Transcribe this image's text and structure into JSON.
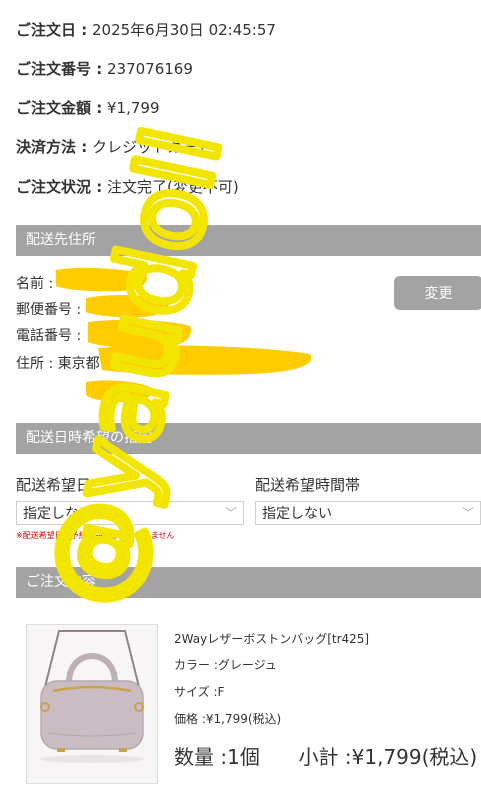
{
  "order": {
    "date": {
      "label": "ご注文日 :",
      "value": " 2025年6月30日 02:45:57"
    },
    "number": {
      "label": "ご注文番号 :",
      "value": " 237076169"
    },
    "amount": {
      "label": "ご注文金額 :",
      "value": " ¥1,799"
    },
    "payment": {
      "label": "決済方法 :",
      "value": " クレジットカード"
    },
    "status": {
      "label": "ご注文状況 :",
      "value": " 注文完了(変更不可)"
    }
  },
  "shipping_address": {
    "title": "配送先住所",
    "name_label": "名前 :",
    "postal_label": "郵便番号 :",
    "phone_label": "電話番号 :",
    "address_label": "住所 : 東京都",
    "change_button": "変更"
  },
  "delivery": {
    "title": "配送日時希望の指定",
    "date_label": "配送希望日",
    "date_value": "指定しない",
    "time_label": "配送希望時間帯",
    "time_value": "指定しない",
    "note": "※配送希望日は予約商品には適用されません"
  },
  "order_contents": {
    "title": "ご注文内容",
    "product": {
      "name": "2Wayレザーボストンバッグ[tr425]",
      "color": "カラー :グレージュ",
      "size": "サイズ :F",
      "price": "価格 :¥1,799(税込)",
      "quantity": "数量 :1個",
      "subtotal": "小計 :¥1,799(税込)"
    }
  },
  "watermark": "@yaudoll",
  "colors": {
    "section_bar": "#a3a3a3",
    "redaction": "#ffcc00",
    "watermark": "#f2e600",
    "note": "#d00000"
  }
}
